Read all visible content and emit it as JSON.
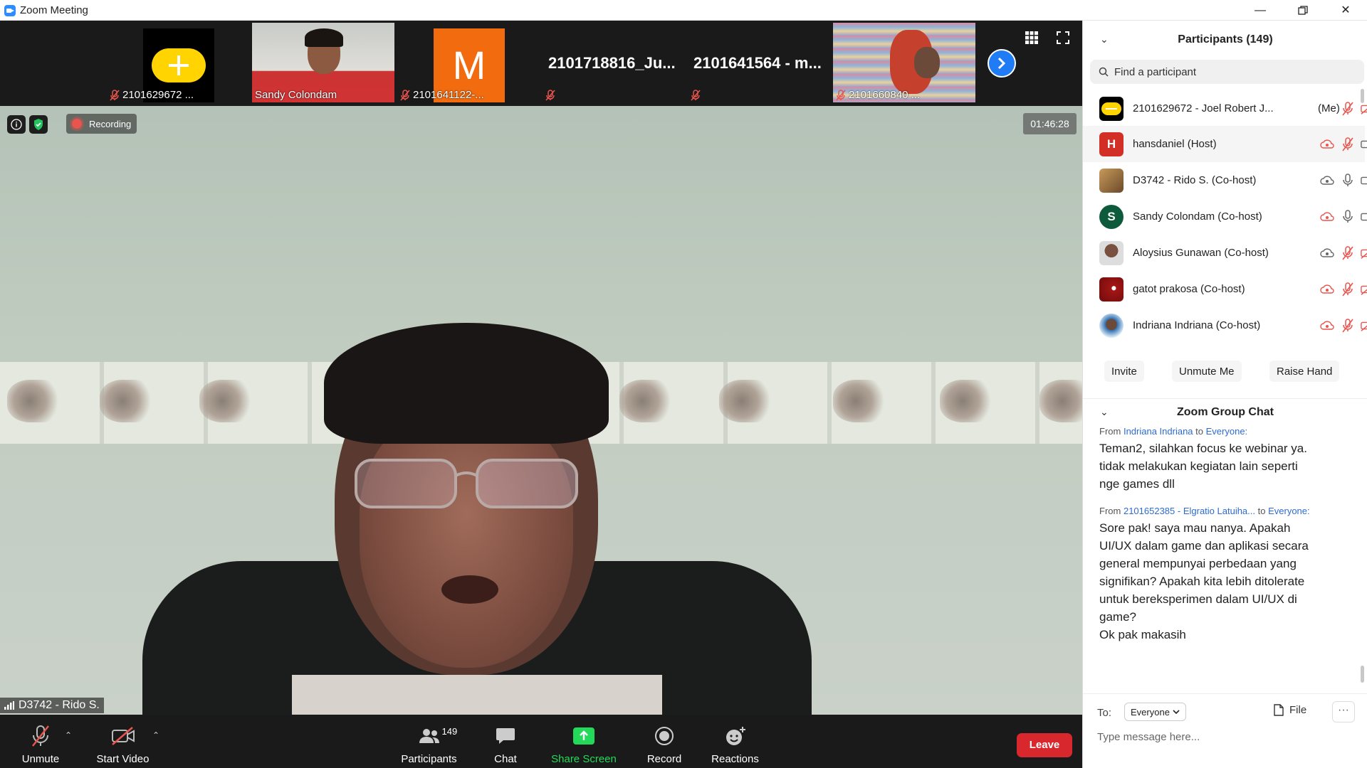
{
  "window": {
    "title": "Zoom Meeting"
  },
  "strip": {
    "thumbs": [
      {
        "name": "2101629672 ...",
        "kind": "avatar-yellow"
      },
      {
        "name": "Sandy Colondam",
        "kind": "video"
      },
      {
        "name": "2101641122-...",
        "kind": "letter",
        "letter": "M"
      },
      {
        "big": "2101718816_Ju...",
        "kind": "text"
      },
      {
        "big": "2101641564 - m...",
        "kind": "text"
      },
      {
        "name": "2101660840 ...",
        "kind": "video-anime"
      }
    ]
  },
  "main": {
    "recording_label": "Recording",
    "timer": "01:46:28",
    "speaker": "D3742 - Rido S."
  },
  "toolbar": {
    "unmute": "Unmute",
    "start_video": "Start Video",
    "participants": "Participants",
    "participants_count": "149",
    "chat": "Chat",
    "share_screen": "Share Screen",
    "record": "Record",
    "reactions": "Reactions",
    "leave": "Leave"
  },
  "participants_panel": {
    "title": "Participants (149)",
    "search_placeholder": "Find a participant",
    "items": [
      {
        "name": "2101629672 - Joel Robert J...",
        "me": "(Me)"
      },
      {
        "name": "hansdaniel (Host)",
        "initial": "H"
      },
      {
        "name": "D3742 - Rido S. (Co-host)"
      },
      {
        "name": "Sandy Colondam (Co-host)",
        "initial": "S"
      },
      {
        "name": "Aloysius Gunawan (Co-host)"
      },
      {
        "name": "gatot prakosa (Co-host)"
      },
      {
        "name": "Indriana Indriana (Co-host)"
      }
    ],
    "buttons": {
      "invite": "Invite",
      "unmute_me": "Unmute Me",
      "raise_hand": "Raise Hand"
    }
  },
  "chat_panel": {
    "title": "Zoom Group Chat",
    "messages": [
      {
        "from_prefix": "From",
        "sender": "Indriana Indriana",
        "to_prefix": "to",
        "recipient": "Everyone:",
        "lines": [
          "Teman2, silahkan focus ke webinar ya.",
          "tidak melakukan kegiatan lain seperti",
          "nge games dll"
        ]
      },
      {
        "from_prefix": "From",
        "sender": "2101652385 - Elgratio Latuiha...",
        "to_prefix": "to",
        "recipient": "Everyone:",
        "lines": [
          "Sore pak! saya mau nanya. Apakah",
          "UI/UX dalam game dan aplikasi secara",
          "general mempunyai perbedaan yang",
          "signifikan? Apakah kita lebih ditolerate",
          "untuk bereksperimen dalam UI/UX di",
          "game?",
          "Ok pak makasih"
        ]
      }
    ],
    "to_label": "To:",
    "to_value": "Everyone",
    "file_label": "File",
    "input_placeholder": "Type message here..."
  },
  "colors": {
    "accent": "#2d8cff",
    "leave": "#d9272e",
    "share": "#23d959",
    "mute": "#e8544e"
  }
}
